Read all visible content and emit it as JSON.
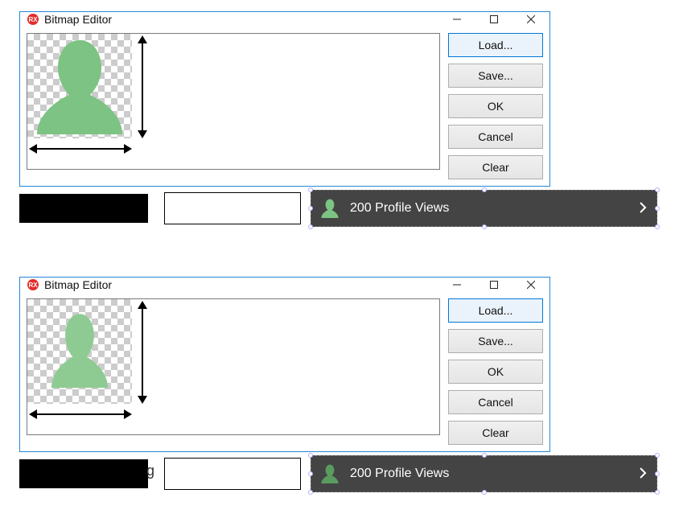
{
  "window": {
    "title": "Bitmap Editor",
    "buttons": {
      "load": "Load...",
      "save": "Save...",
      "ok": "OK",
      "cancel": "Cancel",
      "clear": "Clear"
    }
  },
  "panel": {
    "text": "200 Profile Views"
  },
  "colors": {
    "silhouette_large": "#7dc383",
    "silhouette_small": "#5a9c5f",
    "grid_accent": "#2488d8"
  },
  "top_instance": {
    "silhouette_fills_checker": true,
    "checker_size": [
      130,
      130
    ]
  },
  "bottom_instance": {
    "silhouette_fills_checker": false,
    "checker_size": [
      130,
      130
    ]
  }
}
